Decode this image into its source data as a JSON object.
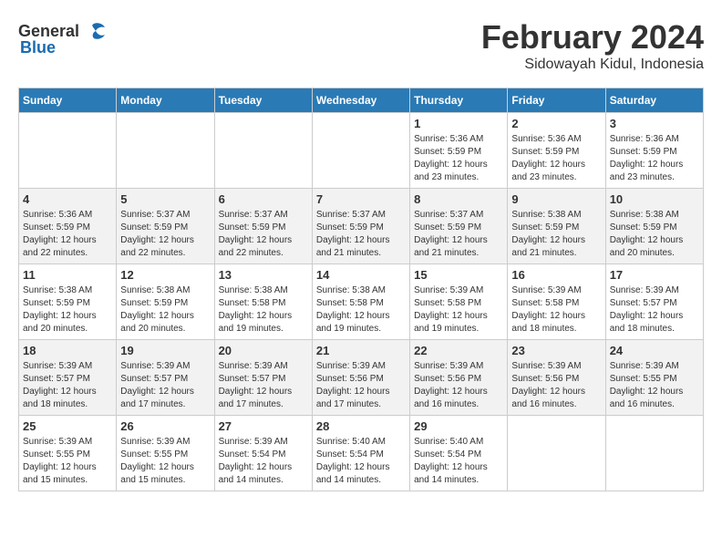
{
  "header": {
    "logo_general": "General",
    "logo_blue": "Blue",
    "month_year": "February 2024",
    "location": "Sidowayah Kidul, Indonesia"
  },
  "calendar": {
    "days_of_week": [
      "Sunday",
      "Monday",
      "Tuesday",
      "Wednesday",
      "Thursday",
      "Friday",
      "Saturday"
    ],
    "weeks": [
      [
        {
          "day": "",
          "info": ""
        },
        {
          "day": "",
          "info": ""
        },
        {
          "day": "",
          "info": ""
        },
        {
          "day": "",
          "info": ""
        },
        {
          "day": "1",
          "info": "Sunrise: 5:36 AM\nSunset: 5:59 PM\nDaylight: 12 hours\nand 23 minutes."
        },
        {
          "day": "2",
          "info": "Sunrise: 5:36 AM\nSunset: 5:59 PM\nDaylight: 12 hours\nand 23 minutes."
        },
        {
          "day": "3",
          "info": "Sunrise: 5:36 AM\nSunset: 5:59 PM\nDaylight: 12 hours\nand 23 minutes."
        }
      ],
      [
        {
          "day": "4",
          "info": "Sunrise: 5:36 AM\nSunset: 5:59 PM\nDaylight: 12 hours\nand 22 minutes."
        },
        {
          "day": "5",
          "info": "Sunrise: 5:37 AM\nSunset: 5:59 PM\nDaylight: 12 hours\nand 22 minutes."
        },
        {
          "day": "6",
          "info": "Sunrise: 5:37 AM\nSunset: 5:59 PM\nDaylight: 12 hours\nand 22 minutes."
        },
        {
          "day": "7",
          "info": "Sunrise: 5:37 AM\nSunset: 5:59 PM\nDaylight: 12 hours\nand 21 minutes."
        },
        {
          "day": "8",
          "info": "Sunrise: 5:37 AM\nSunset: 5:59 PM\nDaylight: 12 hours\nand 21 minutes."
        },
        {
          "day": "9",
          "info": "Sunrise: 5:38 AM\nSunset: 5:59 PM\nDaylight: 12 hours\nand 21 minutes."
        },
        {
          "day": "10",
          "info": "Sunrise: 5:38 AM\nSunset: 5:59 PM\nDaylight: 12 hours\nand 20 minutes."
        }
      ],
      [
        {
          "day": "11",
          "info": "Sunrise: 5:38 AM\nSunset: 5:59 PM\nDaylight: 12 hours\nand 20 minutes."
        },
        {
          "day": "12",
          "info": "Sunrise: 5:38 AM\nSunset: 5:59 PM\nDaylight: 12 hours\nand 20 minutes."
        },
        {
          "day": "13",
          "info": "Sunrise: 5:38 AM\nSunset: 5:58 PM\nDaylight: 12 hours\nand 19 minutes."
        },
        {
          "day": "14",
          "info": "Sunrise: 5:38 AM\nSunset: 5:58 PM\nDaylight: 12 hours\nand 19 minutes."
        },
        {
          "day": "15",
          "info": "Sunrise: 5:39 AM\nSunset: 5:58 PM\nDaylight: 12 hours\nand 19 minutes."
        },
        {
          "day": "16",
          "info": "Sunrise: 5:39 AM\nSunset: 5:58 PM\nDaylight: 12 hours\nand 18 minutes."
        },
        {
          "day": "17",
          "info": "Sunrise: 5:39 AM\nSunset: 5:57 PM\nDaylight: 12 hours\nand 18 minutes."
        }
      ],
      [
        {
          "day": "18",
          "info": "Sunrise: 5:39 AM\nSunset: 5:57 PM\nDaylight: 12 hours\nand 18 minutes."
        },
        {
          "day": "19",
          "info": "Sunrise: 5:39 AM\nSunset: 5:57 PM\nDaylight: 12 hours\nand 17 minutes."
        },
        {
          "day": "20",
          "info": "Sunrise: 5:39 AM\nSunset: 5:57 PM\nDaylight: 12 hours\nand 17 minutes."
        },
        {
          "day": "21",
          "info": "Sunrise: 5:39 AM\nSunset: 5:56 PM\nDaylight: 12 hours\nand 17 minutes."
        },
        {
          "day": "22",
          "info": "Sunrise: 5:39 AM\nSunset: 5:56 PM\nDaylight: 12 hours\nand 16 minutes."
        },
        {
          "day": "23",
          "info": "Sunrise: 5:39 AM\nSunset: 5:56 PM\nDaylight: 12 hours\nand 16 minutes."
        },
        {
          "day": "24",
          "info": "Sunrise: 5:39 AM\nSunset: 5:55 PM\nDaylight: 12 hours\nand 16 minutes."
        }
      ],
      [
        {
          "day": "25",
          "info": "Sunrise: 5:39 AM\nSunset: 5:55 PM\nDaylight: 12 hours\nand 15 minutes."
        },
        {
          "day": "26",
          "info": "Sunrise: 5:39 AM\nSunset: 5:55 PM\nDaylight: 12 hours\nand 15 minutes."
        },
        {
          "day": "27",
          "info": "Sunrise: 5:39 AM\nSunset: 5:54 PM\nDaylight: 12 hours\nand 14 minutes."
        },
        {
          "day": "28",
          "info": "Sunrise: 5:40 AM\nSunset: 5:54 PM\nDaylight: 12 hours\nand 14 minutes."
        },
        {
          "day": "29",
          "info": "Sunrise: 5:40 AM\nSunset: 5:54 PM\nDaylight: 12 hours\nand 14 minutes."
        },
        {
          "day": "",
          "info": ""
        },
        {
          "day": "",
          "info": ""
        }
      ]
    ]
  }
}
